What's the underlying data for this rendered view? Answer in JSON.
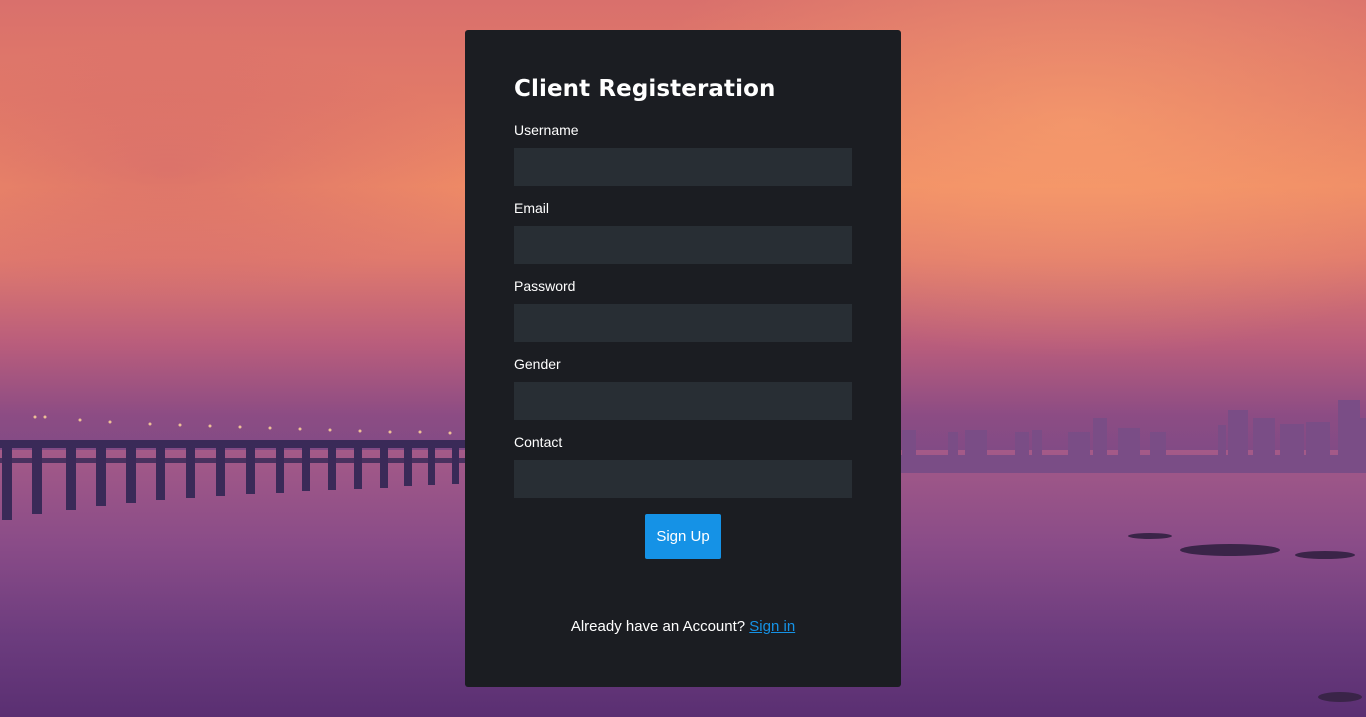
{
  "form": {
    "title": "Client Registeration",
    "fields": [
      {
        "label": "Username",
        "value": "",
        "placeholder": ""
      },
      {
        "label": "Email",
        "value": "",
        "placeholder": ""
      },
      {
        "label": "Password",
        "value": "",
        "placeholder": ""
      },
      {
        "label": "Gender",
        "value": "",
        "placeholder": ""
      },
      {
        "label": "Contact",
        "value": "",
        "placeholder": ""
      }
    ],
    "submit_label": "Sign Up",
    "footer_text": "Already have an Account?",
    "footer_link_label": "Sign in"
  },
  "colors": {
    "card_background": "#1b1d22",
    "input_background": "#282e34",
    "accent": "#1592e6",
    "text": "#ffffff"
  }
}
